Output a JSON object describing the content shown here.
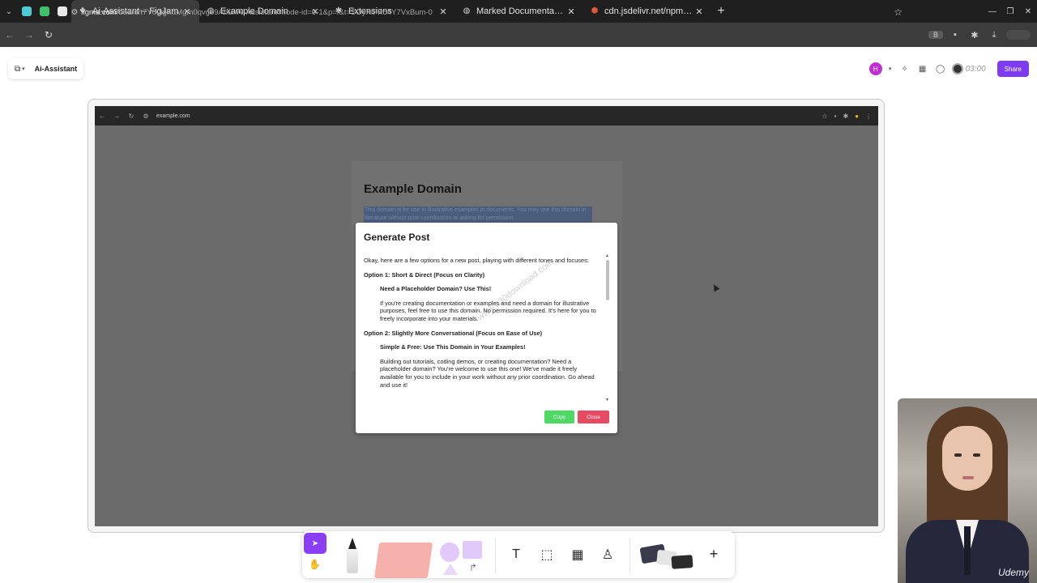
{
  "browser": {
    "tabs": [
      {
        "title": "Ai-Assistant – FigJam",
        "favicon": "figma-icon",
        "active": true
      },
      {
        "title": "Example Domain",
        "favicon": "globe-icon",
        "active": false
      },
      {
        "title": "Extensions",
        "favicon": "puzzle-icon",
        "active": false
      },
      {
        "title": "Marked Documentation",
        "favicon": "globe-icon",
        "active": false
      },
      {
        "title": "cdn.jsdelivr.net/npm/ma",
        "favicon": "shield-icon",
        "active": false
      }
    ],
    "url_host": "figma.com",
    "url_path": "/board/t7Y60qjKdMgm0qvgo9Abur/Ai-Assistant?node-id=0-1&p=f&t=SOyXIFKo4Y7VxBum-0",
    "profile_badge": "B"
  },
  "figjam": {
    "file_name": "Ai-Assistant",
    "avatar_initial": "H",
    "timer": "03:00",
    "share_label": "Share"
  },
  "embedded_browser": {
    "url": "example.com"
  },
  "example_page": {
    "title": "Example Domain",
    "highlighted_text": "This domain is for use in illustrative examples in documents. You may use this domain in literature without prior coordination or asking for permission."
  },
  "modal": {
    "title": "Generate Post",
    "intro": "Okay, here are a few options for a new post, playing with different tones and focuses:",
    "options": [
      {
        "heading": "Option 1: Short & Direct (Focus on Clarity)",
        "subheading": "Need a Placeholder Domain? Use This!",
        "body": "If you're creating documentation or examples and need a domain for illustrative purposes, feel free to use this domain. No permission required. It's here for you to freely incorporate into your materials."
      },
      {
        "heading": "Option 2: Slightly More Conversational (Focus on Ease of Use)",
        "subheading": "Simple & Free: Use This Domain in Your Examples!",
        "body": "Building out tutorials, coding demos, or creating documentation? Need a placeholder domain? You're welcome to use this one! We've made it freely available for you to include in your work without any prior coordination. Go ahead and use it!"
      }
    ],
    "copy_label": "Copy",
    "close_label": "Close",
    "copy_color": "#4dd964",
    "close_color": "#e64b63"
  },
  "watermark": "www.p30download.com",
  "webcam": {
    "brand": "Udemy"
  },
  "colors": {
    "accent": "#7d3cf2",
    "select_tool": "#8b3ff5"
  }
}
